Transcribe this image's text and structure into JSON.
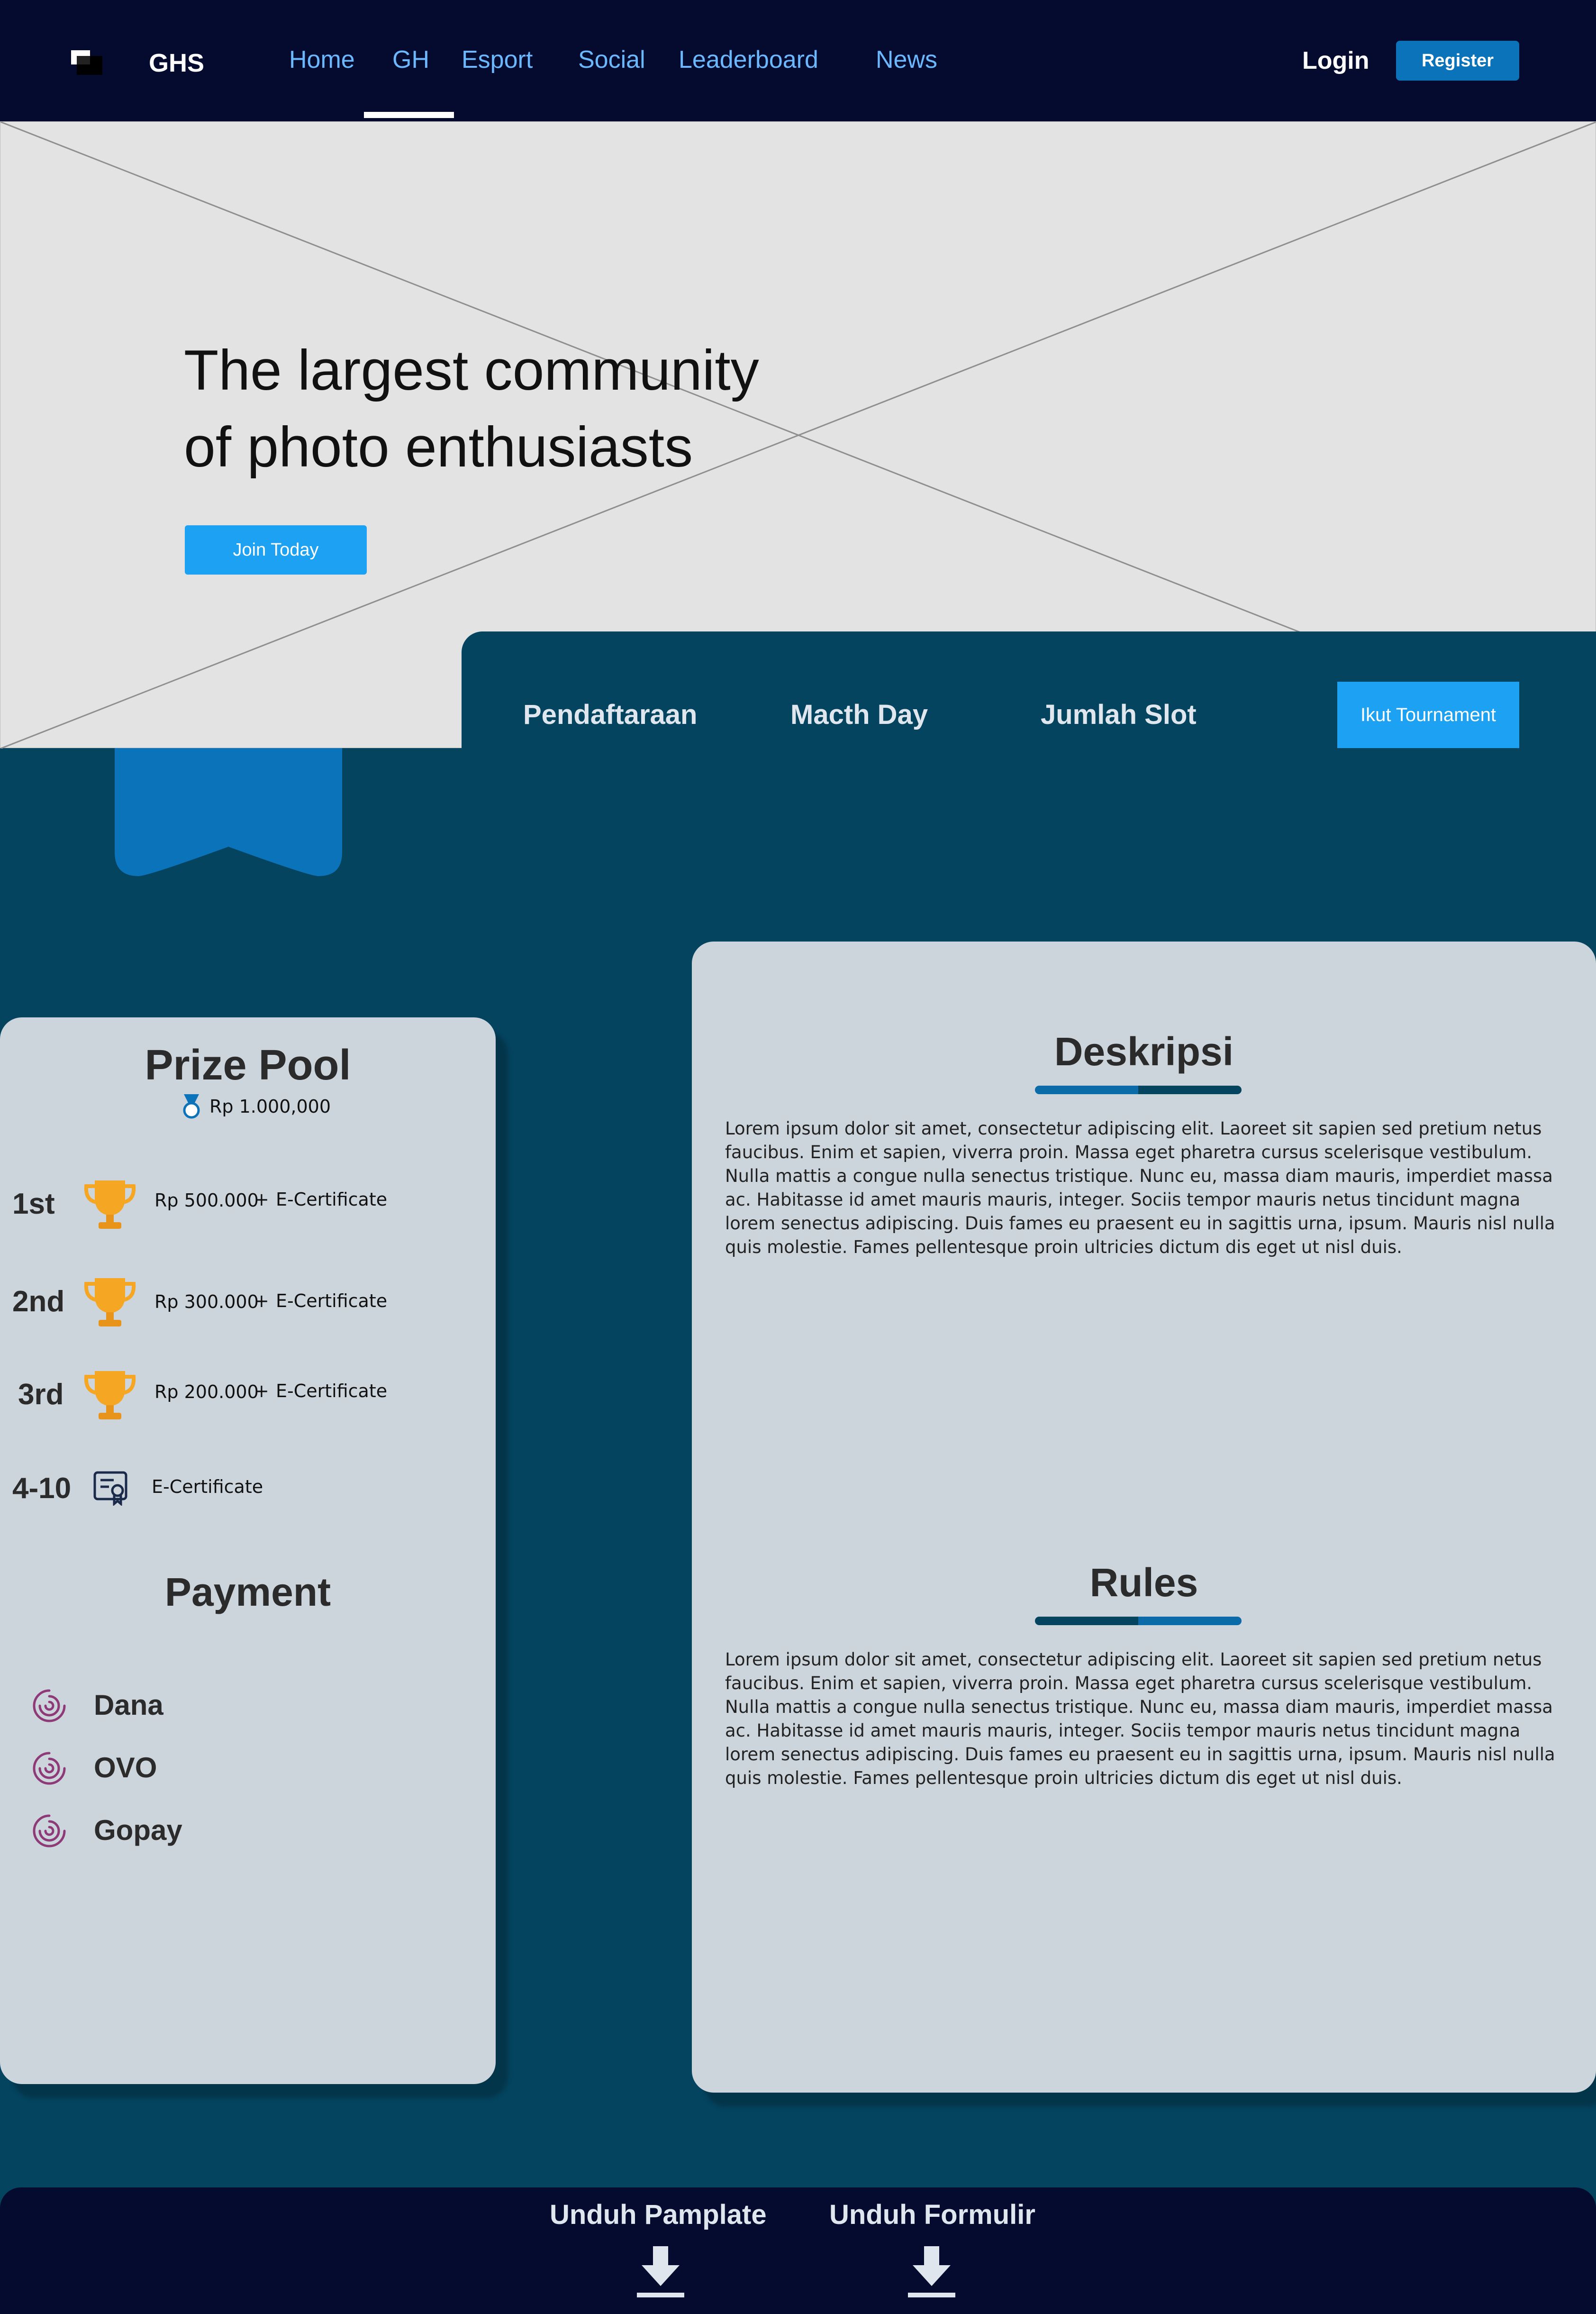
{
  "nav": {
    "brand": "GHS",
    "links": [
      "Home",
      "GH",
      "Esport",
      "Social",
      "Leaderboard",
      "News"
    ],
    "active": "GH",
    "login": "Login",
    "register": "Register"
  },
  "hero": {
    "title_line1": "The largest community",
    "title_line2": "of photo enthusiasts",
    "cta": "Join Today"
  },
  "info": {
    "items": [
      "Pendaftaraan",
      "Macth Day",
      "Jumlah Slot"
    ],
    "cta": "Ikut Tournament"
  },
  "prize": {
    "title": "Prize Pool",
    "total": "Rp 1.000,000",
    "rows": [
      {
        "rank": "1st",
        "amount": "Rp 500.000",
        "plus": "+",
        "extra": "E-Certificate",
        "icon": "trophy-icon"
      },
      {
        "rank": "2nd",
        "amount": "Rp 300.000",
        "plus": "+",
        "extra": "E-Certificate",
        "icon": "trophy-icon"
      },
      {
        "rank": "3rd",
        "amount": "Rp 200.000",
        "plus": "+",
        "extra": "E-Certificate",
        "icon": "trophy-icon"
      },
      {
        "rank": "4-10",
        "extra": "E-Certificate",
        "icon": "certificate-icon"
      }
    ]
  },
  "payment": {
    "title": "Payment",
    "methods": [
      "Dana",
      "OVO",
      "Gopay"
    ]
  },
  "deskripsi": {
    "title": "Deskripsi",
    "text": "Lorem ipsum dolor sit amet, consectetur adipiscing elit. Laoreet sit sapien sed pretium netus faucibus. Enim et sapien, viverra proin. Massa eget pharetra cursus scelerisque vestibulum. Nulla mattis a congue nulla senectus tristique. Nunc eu, massa diam mauris, imperdiet massa ac. Habitasse id amet mauris mauris, integer. Sociis tempor mauris netus tincidunt magna lorem senectus adipiscing. Duis fames eu praesent eu in sagittis urna, ipsum. Mauris nisl nulla quis molestie. Fames pellentesque proin ultricies dictum dis eget ut nisl duis."
  },
  "rules": {
    "title": "Rules",
    "text": "Lorem ipsum dolor sit amet, consectetur adipiscing elit. Laoreet sit sapien sed pretium netus faucibus. Enim et sapien, viverra proin. Massa eget pharetra cursus scelerisque vestibulum. Nulla mattis a congue nulla senectus tristique. Nunc eu, massa diam mauris, imperdiet massa ac. Habitasse id amet mauris mauris, integer. Sociis tempor mauris netus tincidunt magna lorem senectus adipiscing. Duis fames eu praesent eu in sagittis urna, ipsum. Mauris nisl nulla quis molestie. Fames pellentesque proin ultricies dictum dis eget ut nisl duis."
  },
  "footer": {
    "download_pamplate": "Unduh Pamplate",
    "download_formulir": "Unduh Formulir"
  },
  "colors": {
    "nav_bg": "#040b2e",
    "page_bg": "#04445f",
    "accent": "#1da1f2",
    "register_btn": "#0b73b9",
    "nav_link": "#6cb8ff",
    "card_bg": "#cdd5dc"
  }
}
